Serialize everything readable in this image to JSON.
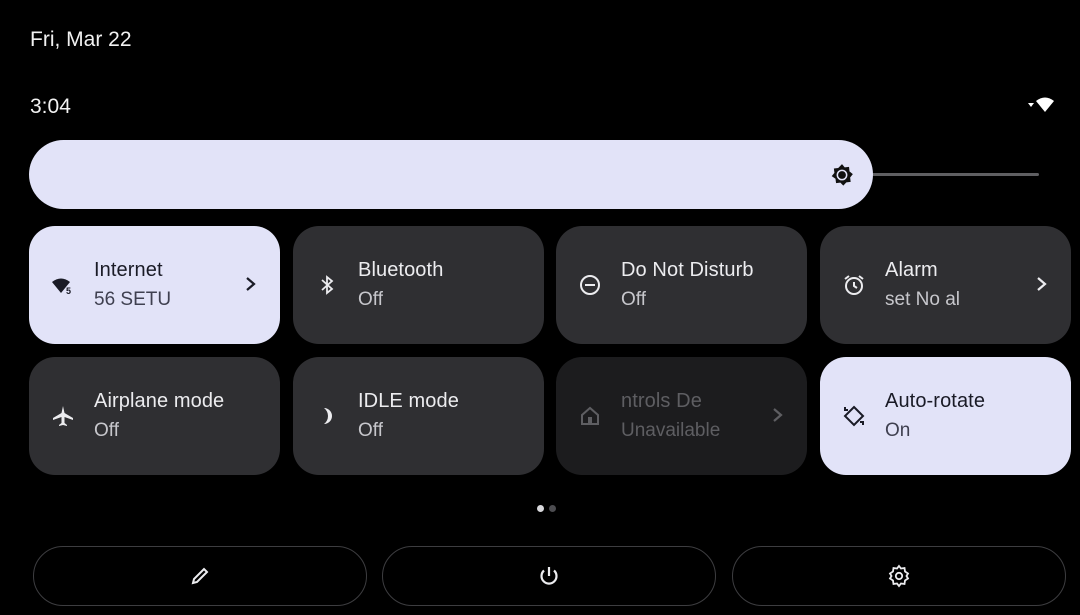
{
  "header": {
    "date": "Fri, Mar 22",
    "time": "3:04"
  },
  "status_bar": {
    "icons": [
      "signal-arrow-icon",
      "wifi-5-icon"
    ]
  },
  "brightness": {
    "level_percent": 82,
    "icon": "brightness-icon"
  },
  "tiles": [
    {
      "name": "internet",
      "label": "Internet",
      "sub": "56     SETU",
      "icon": "wifi-5-icon",
      "state": "active",
      "chevron": true
    },
    {
      "name": "bluetooth",
      "label": "Bluetooth",
      "sub": "Off",
      "icon": "bluetooth-icon",
      "state": "inactive",
      "chevron": false
    },
    {
      "name": "do-not-disturb",
      "label": "Do Not Disturb",
      "sub": "Off",
      "icon": "do-not-disturb-icon",
      "state": "inactive",
      "chevron": false
    },
    {
      "name": "alarm",
      "label": "Alarm",
      "sub": "set      No al",
      "icon": "alarm-icon",
      "state": "inactive",
      "chevron": true
    },
    {
      "name": "airplane-mode",
      "label": "Airplane mode",
      "sub": "Off",
      "icon": "airplane-icon",
      "state": "inactive",
      "chevron": false
    },
    {
      "name": "idle-mode",
      "label": "IDLE mode",
      "sub": "Off",
      "icon": "moon-icon",
      "state": "inactive",
      "chevron": false
    },
    {
      "name": "device-controls",
      "label": "ntrols      De",
      "sub": "Unavailable",
      "icon": "home-icon",
      "state": "disabled",
      "chevron": true
    },
    {
      "name": "auto-rotate",
      "label": "Auto-rotate",
      "sub": "On",
      "icon": "auto-rotate-icon",
      "state": "active",
      "chevron": false
    }
  ],
  "pager": {
    "pages": 2,
    "current": 1
  },
  "bottom_bar": [
    {
      "name": "edit-button",
      "icon": "pencil-icon"
    },
    {
      "name": "power-button",
      "icon": "power-icon"
    },
    {
      "name": "settings-button",
      "icon": "gear-icon"
    }
  ]
}
